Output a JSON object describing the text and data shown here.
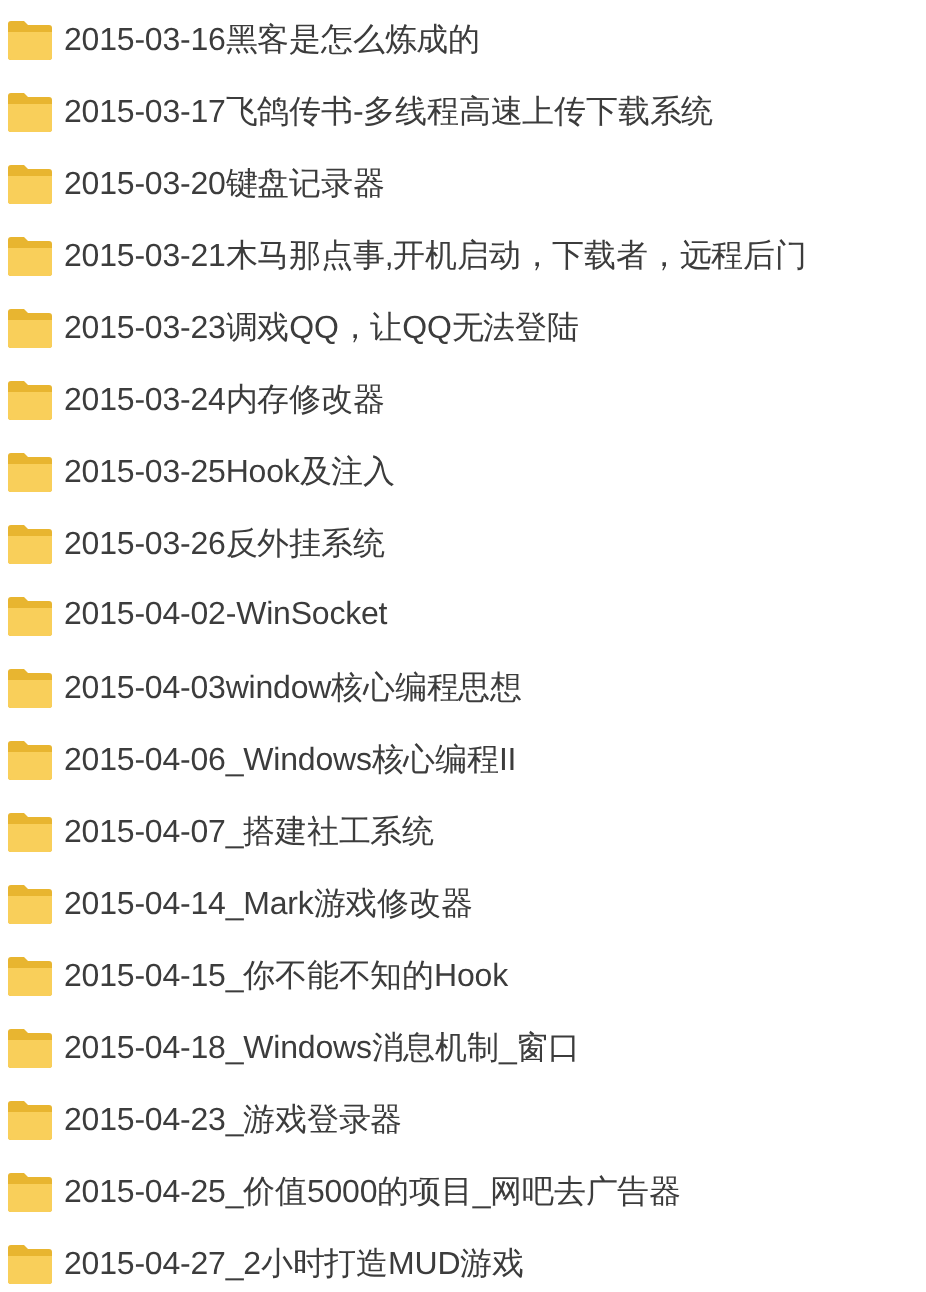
{
  "folders": [
    {
      "name": "2015-03-16黑客是怎么炼成的"
    },
    {
      "name": "2015-03-17飞鸽传书-多线程高速上传下载系统"
    },
    {
      "name": "2015-03-20键盘记录器"
    },
    {
      "name": "2015-03-21木马那点事,开机启动，下载者，远程后门"
    },
    {
      "name": "2015-03-23调戏QQ，让QQ无法登陆"
    },
    {
      "name": "2015-03-24内存修改器"
    },
    {
      "name": "2015-03-25Hook及注入"
    },
    {
      "name": "2015-03-26反外挂系统"
    },
    {
      "name": "2015-04-02-WinSocket"
    },
    {
      "name": "2015-04-03window核心编程思想"
    },
    {
      "name": "2015-04-06_Windows核心编程II"
    },
    {
      "name": "2015-04-07_搭建社工系统"
    },
    {
      "name": "2015-04-14_Mark游戏修改器"
    },
    {
      "name": "2015-04-15_你不能不知的Hook"
    },
    {
      "name": "2015-04-18_Windows消息机制_窗口"
    },
    {
      "name": "2015-04-23_游戏登录器"
    },
    {
      "name": "2015-04-25_价值5000的项目_网吧去广告器"
    },
    {
      "name": "2015-04-27_2小时打造MUD游戏"
    }
  ]
}
